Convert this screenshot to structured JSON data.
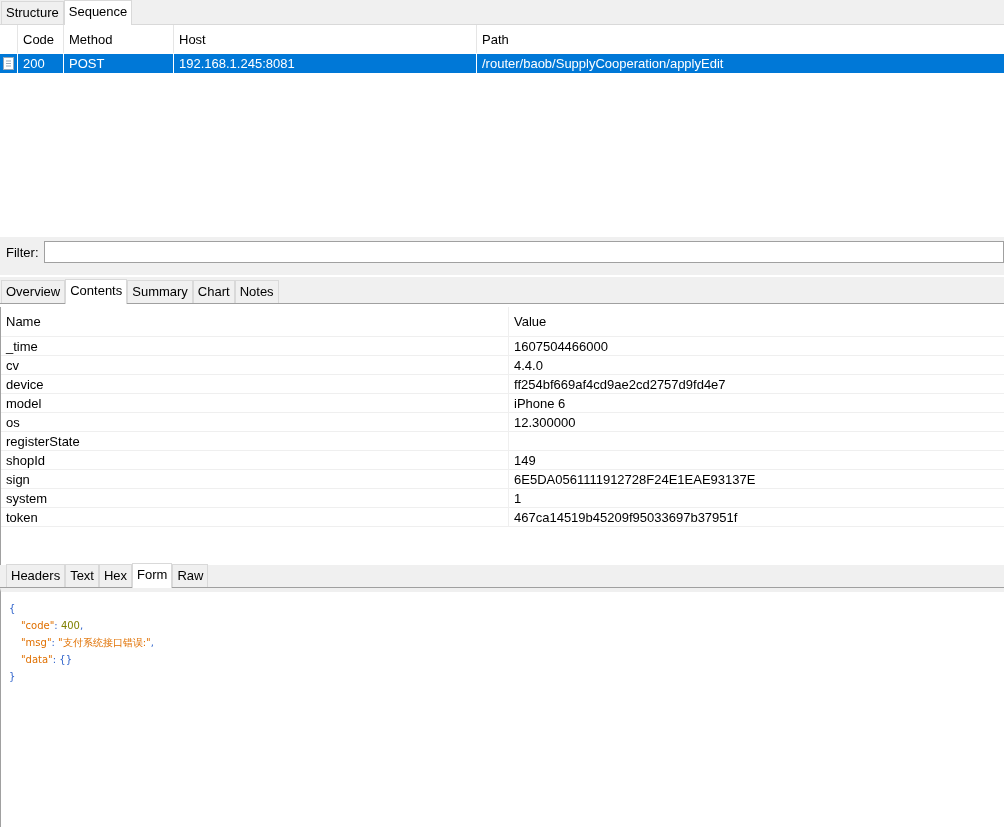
{
  "top_tabs": [
    {
      "label": "Structure",
      "selected": false
    },
    {
      "label": "Sequence",
      "selected": true
    }
  ],
  "sequence_table": {
    "columns": [
      "Code",
      "Method",
      "Host",
      "Path"
    ],
    "rows": [
      {
        "selected": true,
        "cells": [
          "200",
          "POST",
          "192.168.1.245:8081",
          "/router/baob/SupplyCooperation/applyEdit"
        ]
      }
    ]
  },
  "filter": {
    "label": "Filter:"
  },
  "detail_tabs": [
    {
      "label": "Overview",
      "selected": false
    },
    {
      "label": "Contents",
      "selected": true
    },
    {
      "label": "Summary",
      "selected": false
    },
    {
      "label": "Chart",
      "selected": false
    },
    {
      "label": "Notes",
      "selected": false
    }
  ],
  "contents_table": {
    "columns": [
      "Name",
      "Value"
    ],
    "rows": [
      [
        "_time",
        "1607504466000"
      ],
      [
        "cv",
        "4.4.0"
      ],
      [
        "device",
        "ff254bf669af4cd9ae2cd2757d9fd4e7"
      ],
      [
        "model",
        "iPhone 6"
      ],
      [
        "os",
        "12.300000"
      ],
      [
        "registerState",
        ""
      ],
      [
        "shopId",
        "149"
      ],
      [
        "sign",
        "6E5DA0561111912728F24E1EAE93137E"
      ],
      [
        "system",
        "1"
      ],
      [
        "token",
        "467ca14519b45209f95033697b37951f"
      ]
    ]
  },
  "response_tabs": [
    {
      "label": "Headers",
      "selected": false
    },
    {
      "label": "Text",
      "selected": false
    },
    {
      "label": "Hex",
      "selected": false
    },
    {
      "label": "Form",
      "selected": true
    },
    {
      "label": "Raw",
      "selected": false
    }
  ],
  "response_json": [
    [
      {
        "kind": "punct",
        "text": "{"
      }
    ],
    [
      {
        "kind": "key",
        "text": "\"code\""
      },
      {
        "kind": "punct",
        "text": ": "
      },
      {
        "kind": "number",
        "text": "400"
      },
      {
        "kind": "punct",
        "text": ","
      }
    ],
    [
      {
        "kind": "key",
        "text": "\"msg\""
      },
      {
        "kind": "punct",
        "text": ": "
      },
      {
        "kind": "string",
        "text": "\"支付系统接口错误:\""
      },
      {
        "kind": "punct",
        "text": ","
      }
    ],
    [
      {
        "kind": "key",
        "text": "\"data\""
      },
      {
        "kind": "punct",
        "text": ": "
      },
      {
        "kind": "punct",
        "text": "{}"
      }
    ],
    [
      {
        "kind": "punct",
        "text": "}"
      }
    ]
  ]
}
